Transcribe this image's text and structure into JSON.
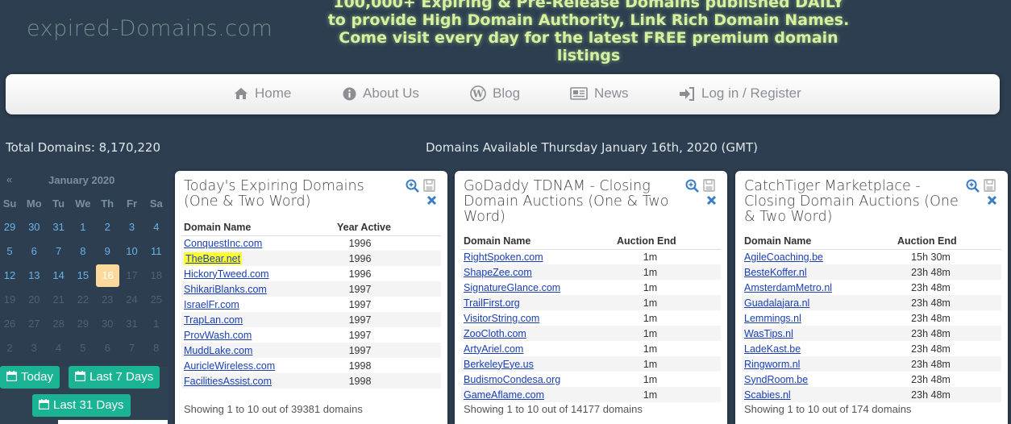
{
  "header": {
    "logo": "expired-Domains.com",
    "tagline": "100,000+ Expiring & Pre-Release Domains published DAILY to provide High Domain Authority, Link Rich Domain Names. Come visit every day for the latest FREE premium domain listings"
  },
  "nav": {
    "items": [
      {
        "label": "Home",
        "icon": "home-icon"
      },
      {
        "label": "About Us",
        "icon": "info-icon"
      },
      {
        "label": "Blog",
        "icon": "wordpress-icon"
      },
      {
        "label": "News",
        "icon": "newspaper-icon"
      },
      {
        "label": "Log in / Register",
        "icon": "sign-in-icon"
      }
    ]
  },
  "stats": {
    "total": "Total Domains: 8,170,220",
    "available": "Domains Available Thursday January 16th, 2020 (GMT)"
  },
  "calendar": {
    "prev": "«",
    "month": "January 2020",
    "days_of_week": [
      "Su",
      "Mo",
      "Tu",
      "We",
      "Th",
      "Fr",
      "Sa"
    ],
    "weeks": [
      [
        "29",
        "30",
        "31",
        "1",
        "2",
        "3",
        "4"
      ],
      [
        "5",
        "6",
        "7",
        "8",
        "9",
        "10",
        "11"
      ],
      [
        "12",
        "13",
        "14",
        "15",
        "16",
        "17",
        "18"
      ],
      [
        "19",
        "20",
        "21",
        "22",
        "23",
        "24",
        "25"
      ],
      [
        "26",
        "27",
        "28",
        "29",
        "30",
        "31",
        "1"
      ],
      [
        "2",
        "3",
        "4",
        "5",
        "6",
        "7",
        "8"
      ]
    ],
    "today": "16",
    "buttons": {
      "today": "Today",
      "last7": "Last 7 Days",
      "last31": "Last 31 Days"
    },
    "colors": {
      "button": "#1ab394",
      "today_bg": "#fbd89b",
      "active_day": "#6ab2e6"
    }
  },
  "panels": [
    {
      "title": "Today's Expiring Domains (One & Two Word)",
      "col1": "Domain Name",
      "col2": "Year Active",
      "rows": [
        [
          "ConquestInc.com",
          "1996"
        ],
        [
          "TheBear.net",
          "1996"
        ],
        [
          "HickoryTweed.com",
          "1996"
        ],
        [
          "ShikariBlanks.com",
          "1997"
        ],
        [
          "IsraelFr.com",
          "1997"
        ],
        [
          "TrapLan.com",
          "1997"
        ],
        [
          "ProvWash.com",
          "1997"
        ],
        [
          "MuddLake.com",
          "1997"
        ],
        [
          "AuricleWireless.com",
          "1998"
        ],
        [
          "FacilitiesAssist.com",
          "1998"
        ]
      ],
      "footer": "Showing 1 to 10 out of 39381 domains"
    },
    {
      "title": "GoDaddy TDNAM - Closing Domain Auctions (One & Two Word)",
      "col1": "Domain Name",
      "col2": "Auction End",
      "rows": [
        [
          "RightSpoken.com",
          "1m"
        ],
        [
          "ShapeZee.com",
          "1m"
        ],
        [
          "SignatureGlance.com",
          "1m"
        ],
        [
          "TrailFirst.org",
          "1m"
        ],
        [
          "VisitorString.com",
          "1m"
        ],
        [
          "ZooCloth.com",
          "1m"
        ],
        [
          "ArtyAriel.com",
          "1m"
        ],
        [
          "BerkeleyEye.us",
          "1m"
        ],
        [
          "BudismoCondesa.org",
          "1m"
        ],
        [
          "GameAflame.com",
          "1m"
        ]
      ],
      "footer": "Showing 1 to 10 out of 14177 domains"
    },
    {
      "title": "CatchTiger Marketplace - Closing Domain Auctions (One & Two Word)",
      "col1": "Domain Name",
      "col2": "Auction End",
      "rows": [
        [
          "AgileCoaching.be",
          "15h 30m"
        ],
        [
          "BesteKoffer.nl",
          "23h 48m"
        ],
        [
          "AmsterdamMetro.nl",
          "23h 48m"
        ],
        [
          "Guadalajara.nl",
          "23h 48m"
        ],
        [
          "Lemmings.nl",
          "23h 48m"
        ],
        [
          "WasTips.nl",
          "23h 48m"
        ],
        [
          "LadeKast.be",
          "23h 48m"
        ],
        [
          "Ringworm.nl",
          "23h 48m"
        ],
        [
          "SyndRoom.be",
          "23h 48m"
        ],
        [
          "Scabies.nl",
          "23h 48m"
        ]
      ],
      "footer": "Showing 1 to 10 out of 174 domains"
    }
  ],
  "colors": {
    "background": "#2c3e50",
    "link": "#1a3fb5",
    "highlight": "#ffff33",
    "tagline": "#d7f0a0"
  }
}
